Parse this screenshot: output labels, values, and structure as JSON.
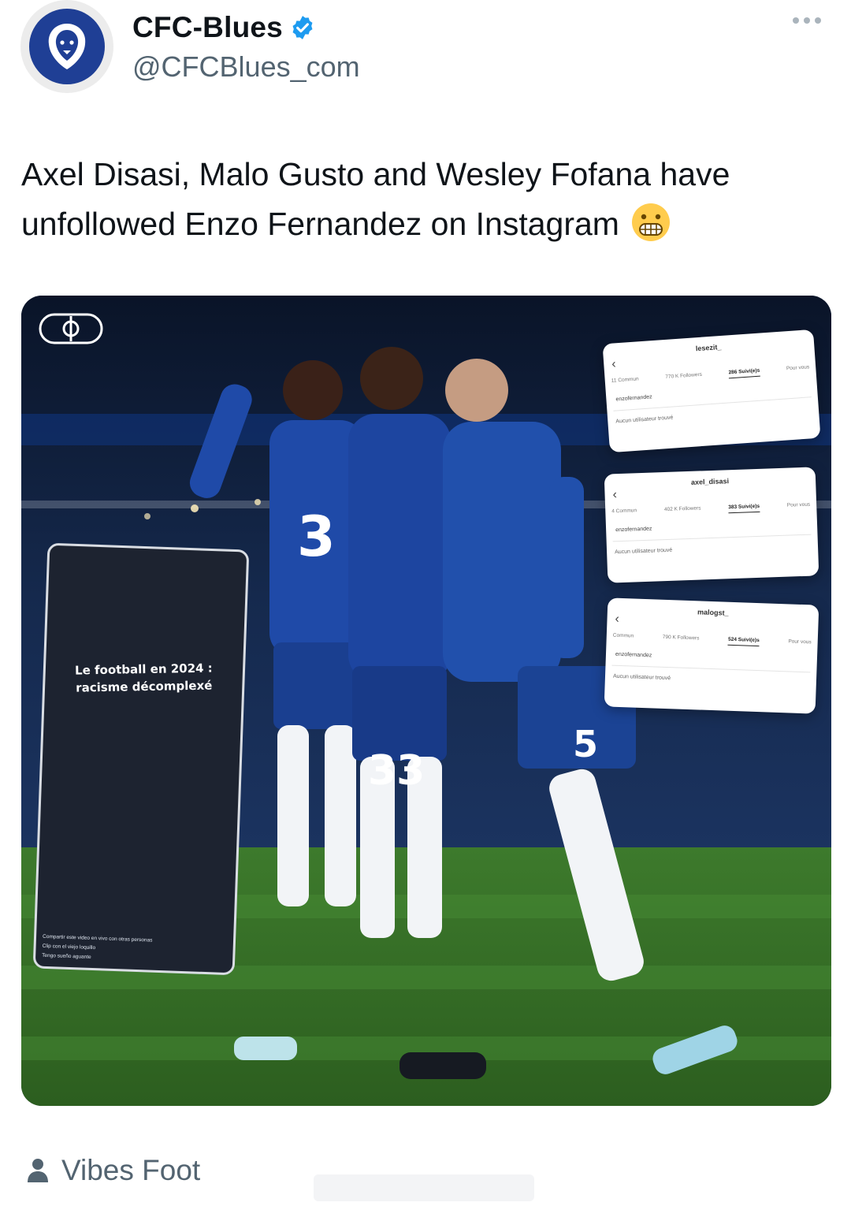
{
  "header": {
    "display_name": "CFC-Blues",
    "handle": "@CFCBlues_com",
    "verified": true,
    "more_icon": "more-horizontal-icon"
  },
  "tweet": {
    "text": "Axel Disasi, Malo Gusto and Wesley Fofana have unfollowed Enzo Fernandez on Instagram",
    "emoji": "grimacing-face"
  },
  "media": {
    "logo_icon": "football-channel-logo-icon",
    "story": {
      "caption_line1": "Le football en 2024 :",
      "caption_line2": "racisme décomplexé",
      "comments": [
        "Compartir este video en vivo con otras personas",
        "Clip con el viejo loquillo",
        "Tengo sueño aguante"
      ]
    },
    "insta_cards": [
      {
        "username": "lesezit_",
        "stats": [
          "11 Commun",
          "770 K Followers",
          "286 Suivi(e)s",
          "Pour vous"
        ],
        "search": "enzofernandez",
        "empty_text": "Aucun utilisateur trouvé"
      },
      {
        "username": "axel_disasi",
        "stats": [
          "4 Commun",
          "402 K Followers",
          "383 Suivi(e)s",
          "Pour vous"
        ],
        "search": "enzofernandez",
        "empty_text": "Aucun utilisateur trouvé"
      },
      {
        "username": "malogst_",
        "stats": [
          "Commun",
          "790 K Followers",
          "524 Suivi(e)s",
          "Pour vous"
        ],
        "search": "enzofernandez",
        "empty_text": "Aucun utilisateur trouvé"
      }
    ],
    "shirt_numbers": [
      "3",
      "33",
      "5"
    ]
  },
  "footer": {
    "source_label": "Vibes Foot",
    "source_icon": "person-icon"
  },
  "colors": {
    "text": "#0f1419",
    "secondary": "#536471",
    "verified": "#1d9bf0",
    "chelsea_blue": "#1f3f95"
  }
}
